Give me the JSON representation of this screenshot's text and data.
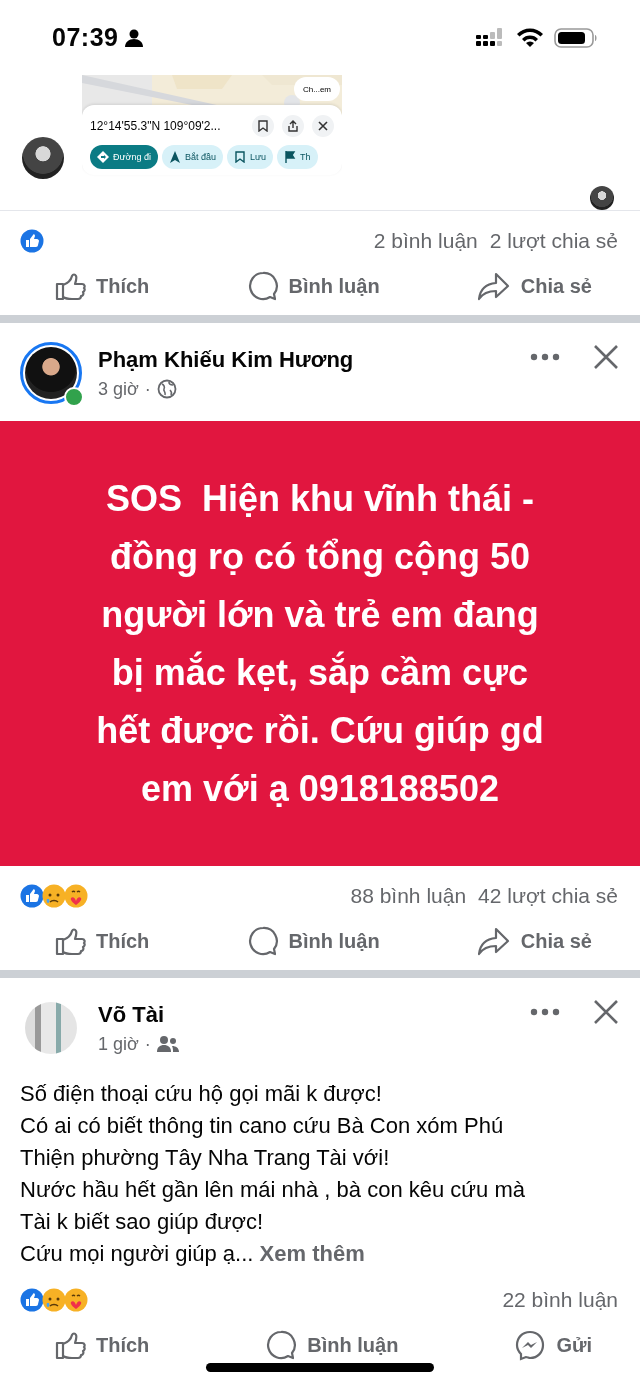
{
  "status_bar": {
    "time": "07:39"
  },
  "previous_post": {
    "map_shot": {
      "place_button": "Ch...em",
      "coordinates": "12°14'55.3\"N 109°09'2...",
      "chips": [
        {
          "label": "Đường đi",
          "kind": "directions",
          "selected": true
        },
        {
          "label": "Bắt đầu",
          "kind": "start",
          "selected": false
        },
        {
          "label": "Lưu",
          "kind": "save",
          "selected": false
        },
        {
          "label": "Th",
          "kind": "flag",
          "selected": false
        }
      ]
    },
    "reactions": [
      {
        "kind": "like"
      }
    ],
    "stats": [
      "2 bình luận",
      "2 lượt chia sẻ"
    ],
    "actions": [
      {
        "kind": "like",
        "label": "Thích"
      },
      {
        "kind": "comment",
        "label": "Bình luận"
      },
      {
        "kind": "share",
        "label": "Chia sẻ"
      }
    ]
  },
  "posts": [
    {
      "author": "Phạm Khiếu Kim Hương",
      "time": "3 giờ",
      "separator": "·",
      "audience": {
        "kind": "public"
      },
      "has_story": true,
      "online": true,
      "banner": "SOS  Hiện khu vĩnh thái -\nđồng rọ có tổng cộng 50\nngười lớn và trẻ em đang\nbị mắc kẹt, sắp cầm cực\nhết được rồi. Cứu giúp gd\nem với ạ 0918188502",
      "reactions": [
        {
          "kind": "like"
        },
        {
          "kind": "sad"
        },
        {
          "kind": "care"
        }
      ],
      "stats": [
        "88 bình luận",
        "42 lượt chia sẻ"
      ],
      "actions": [
        {
          "kind": "like",
          "label": "Thích"
        },
        {
          "kind": "comment",
          "label": "Bình luận"
        },
        {
          "kind": "share",
          "label": "Chia sẻ"
        }
      ]
    },
    {
      "author": "Võ Tài",
      "time": "1 giờ",
      "separator": "·",
      "audience": {
        "kind": "friends"
      },
      "has_story": false,
      "online": false,
      "text": "Số điện thoại cứu hộ gọi mãi k được!\nCó ai có biết thông tin cano cứu Bà Con xóm Phú\nThiện phường Tây Nha Trang Tài với!\nNước hầu hết gần lên mái nhà , bà con kêu cứu mà\nTài k biết sao giúp được!\nCứu mọi người giúp ạ...",
      "see_more": "Xem thêm",
      "reactions": [
        {
          "kind": "like"
        },
        {
          "kind": "sad"
        },
        {
          "kind": "care"
        }
      ],
      "stats": [
        "22 bình luận"
      ],
      "actions": [
        {
          "kind": "like",
          "label": "Thích"
        },
        {
          "kind": "comment",
          "label": "Bình luận"
        },
        {
          "kind": "send",
          "label": "Gửi"
        }
      ]
    }
  ]
}
